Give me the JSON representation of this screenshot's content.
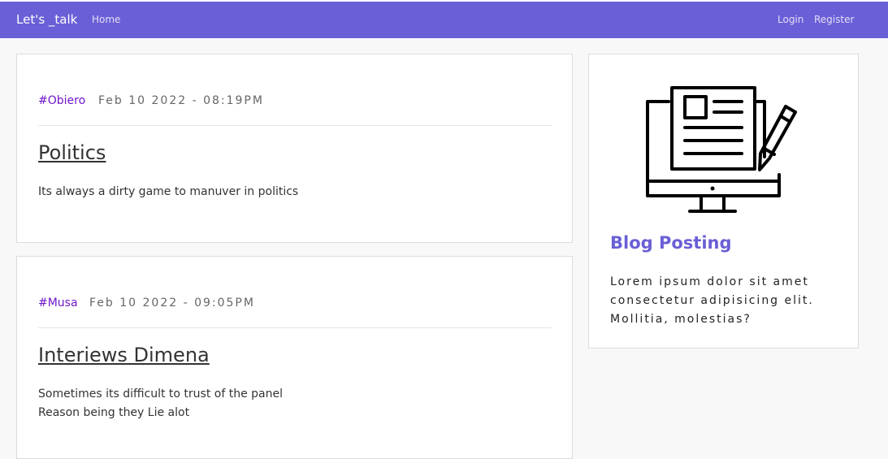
{
  "navbar": {
    "brand": "Let's _talk",
    "links": {
      "home": "Home",
      "login": "Login",
      "register": "Register"
    }
  },
  "posts": [
    {
      "author": "#Obiero",
      "date": "Feb 10 2022 - 08:19PM",
      "title": "Politics",
      "body": [
        "Its always a dirty game to manuver in politics"
      ]
    },
    {
      "author": "#Musa",
      "date": "Feb 10 2022 - 09:05PM",
      "title": "Interiews Dimena",
      "body": [
        "Sometimes its difficult to trust of the panel",
        "Reason being they Lie alot"
      ]
    }
  ],
  "sidebar": {
    "icon": "blog-posting-icon",
    "title": "Blog Posting",
    "text": "Lorem ipsum dolor sit amet consectetur adipisicing elit. Mollitia, molestias?"
  },
  "colors": {
    "navbar": "#6a5fd6",
    "author_link": "#6f16c9",
    "sidebar_title": "#6a5fd6"
  }
}
